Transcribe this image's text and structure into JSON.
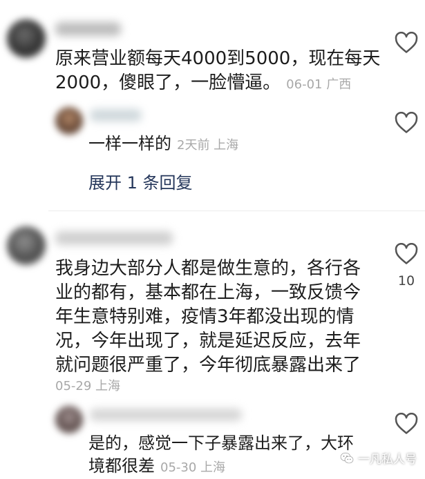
{
  "comments": [
    {
      "text_line1": "原来营业额每天4000到5000，现在每天",
      "text_line2": "2000，傻眼了，一脸懵逼。",
      "meta": "06-01 广西",
      "like_count": ""
    },
    {
      "text_line1": "我身边大部分人都是做生意的，各行各",
      "text_line2": "业的都有，基本都在上海，一致反馈今",
      "text_line3": "年生意特别难，疫情3年都没出现的情",
      "text_line4": "况，今年出现了，就是延迟反应，去年",
      "text_line5": "就问题很严重了，今年彻底暴露出来了",
      "meta": "05-29 上海",
      "like_count": "10"
    }
  ],
  "replies": [
    {
      "text": "一样一样的",
      "meta": "2天前 上海"
    },
    {
      "text_line1": "是的，感觉一下子暴露出来了，大环",
      "text_line2": "境都很差",
      "meta": "05-30 上海"
    }
  ],
  "expand_replies": "展开 1 条回复",
  "watermark": "一凡私人号",
  "icons": {
    "like": "heart-outline-icon",
    "watermark": "wechat-icon"
  },
  "colors": {
    "text": "#1c1c1c",
    "meta": "#a8a8a8",
    "link": "#24365a",
    "heart": "#555555"
  }
}
